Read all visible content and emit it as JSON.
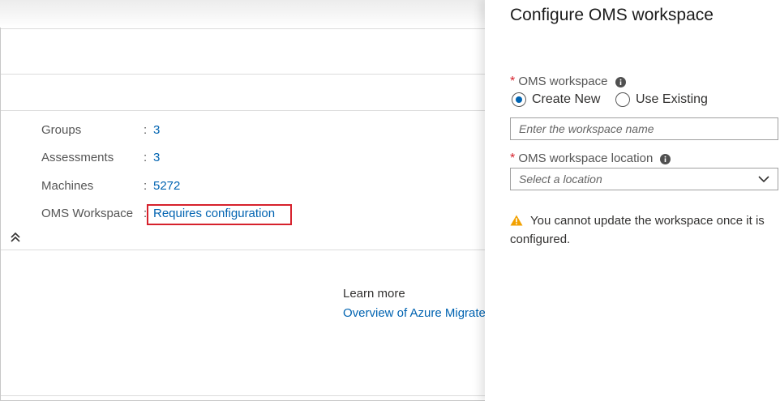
{
  "summary": {
    "rows": [
      {
        "label": "Groups",
        "value": "3"
      },
      {
        "label": "Assessments",
        "value": "3"
      },
      {
        "label": "Machines",
        "value": "5272"
      },
      {
        "label": "OMS Workspace",
        "value": "Requires configuration"
      }
    ],
    "separator": ":"
  },
  "learn_more": {
    "heading": "Learn more",
    "link": "Overview of Azure Migrate"
  },
  "blade": {
    "title": "Configure OMS workspace",
    "required_marker": "*",
    "workspace_label": "OMS workspace",
    "radio_create_new": "Create New",
    "radio_use_existing": "Use Existing",
    "selected_option": "Create New",
    "workspace_name_placeholder": "Enter the workspace name",
    "location_label": "OMS workspace location",
    "location_placeholder": "Select a location",
    "warning": "You cannot update the workspace once it is configured."
  },
  "colors": {
    "link": "#0063b1",
    "required": "#d6212c",
    "highlight_border": "#d6212c",
    "warning_icon": "#f2a100"
  },
  "icons": [
    "info-icon",
    "chevron-down-icon",
    "warning-icon",
    "collapse-up-icon"
  ]
}
